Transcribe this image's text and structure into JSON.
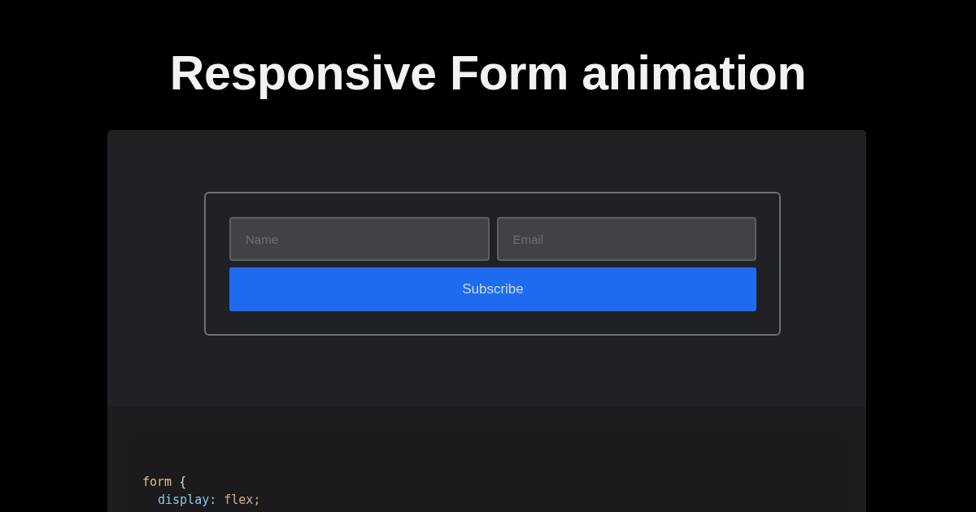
{
  "title": "Responsive Form animation",
  "demo": {
    "fields": [
      {
        "placeholder": "Name"
      },
      {
        "placeholder": "Email"
      }
    ],
    "button": "Subscribe"
  },
  "code": {
    "lines": [
      {
        "kind": "rule-open",
        "tokens": [
          {
            "kind": "selector",
            "text": "form"
          },
          {
            "kind": "punct",
            "text": "{"
          }
        ]
      },
      {
        "kind": "declaration",
        "tokens": [
          {
            "kind": "property",
            "text": "display:"
          },
          {
            "kind": "value",
            "text": "flex;"
          }
        ]
      }
    ]
  }
}
